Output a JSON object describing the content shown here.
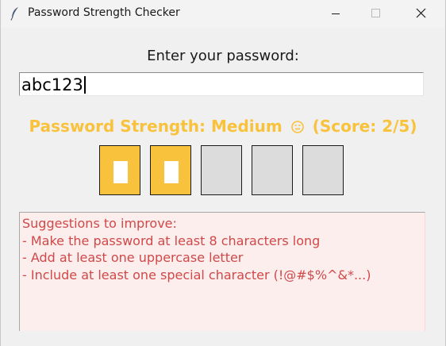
{
  "window": {
    "title": "Password Strength Checker",
    "icon": "feather-icon"
  },
  "form": {
    "prompt": "Enter your password:",
    "password_value": "abc123"
  },
  "strength": {
    "text_before": "Password Strength: Medium",
    "emoji": "neutral-face-emoji",
    "text_after": "(Score: 2/5)",
    "score": 2,
    "max_score": 5,
    "color": "#f9c23c"
  },
  "meter": {
    "filled_color": "#f9c23c",
    "empty_color": "#dcdcdc",
    "segments": [
      {
        "filled": true
      },
      {
        "filled": true
      },
      {
        "filled": false
      },
      {
        "filled": false
      },
      {
        "filled": false
      }
    ]
  },
  "suggestions": {
    "text_color": "#d04848",
    "background": "#fdeeee",
    "lines": [
      "Suggestions to improve:",
      "- Make the password at least 8 characters long",
      "- Add at least one uppercase letter",
      "- Include at least one special character (!@#$%^&*...)"
    ]
  }
}
